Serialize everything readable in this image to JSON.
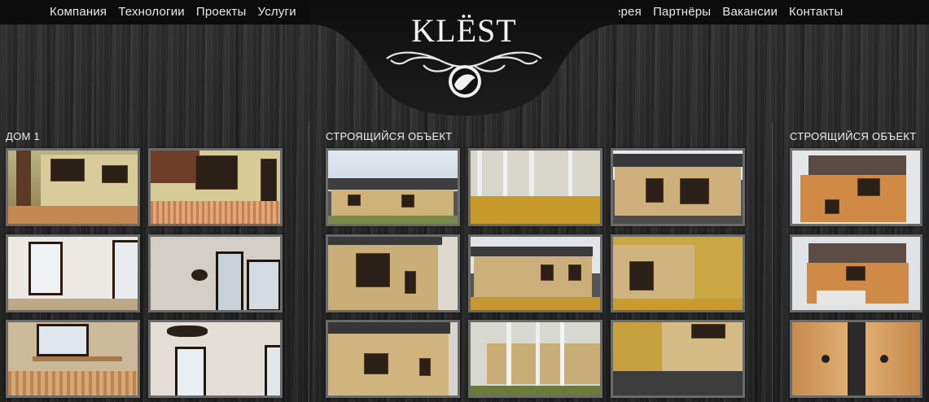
{
  "nav": {
    "left": [
      "Компания",
      "Технологии",
      "Проекты",
      "Услуги"
    ],
    "right": [
      "Галерея",
      "Партнёры",
      "Вакансии",
      "Контакты"
    ]
  },
  "logo": {
    "text": "KLЁST",
    "emblem": "bird-emblem-icon"
  },
  "columns": [
    {
      "title": "ДОМ 1"
    },
    {
      "title": "СТРОЯЩИЙСЯ ОБЪЕКТ"
    },
    {
      "title": "СТРОЯЩИЙСЯ ОБЪЕКТ"
    }
  ],
  "colors": {
    "topbar": "#0c0c0c",
    "wood": "#262626",
    "thumb_border": "#6a6a6a",
    "log_wall": "#c8ae78",
    "roof": "#3a3a3a",
    "birch_yellow": "#c79a2c"
  }
}
